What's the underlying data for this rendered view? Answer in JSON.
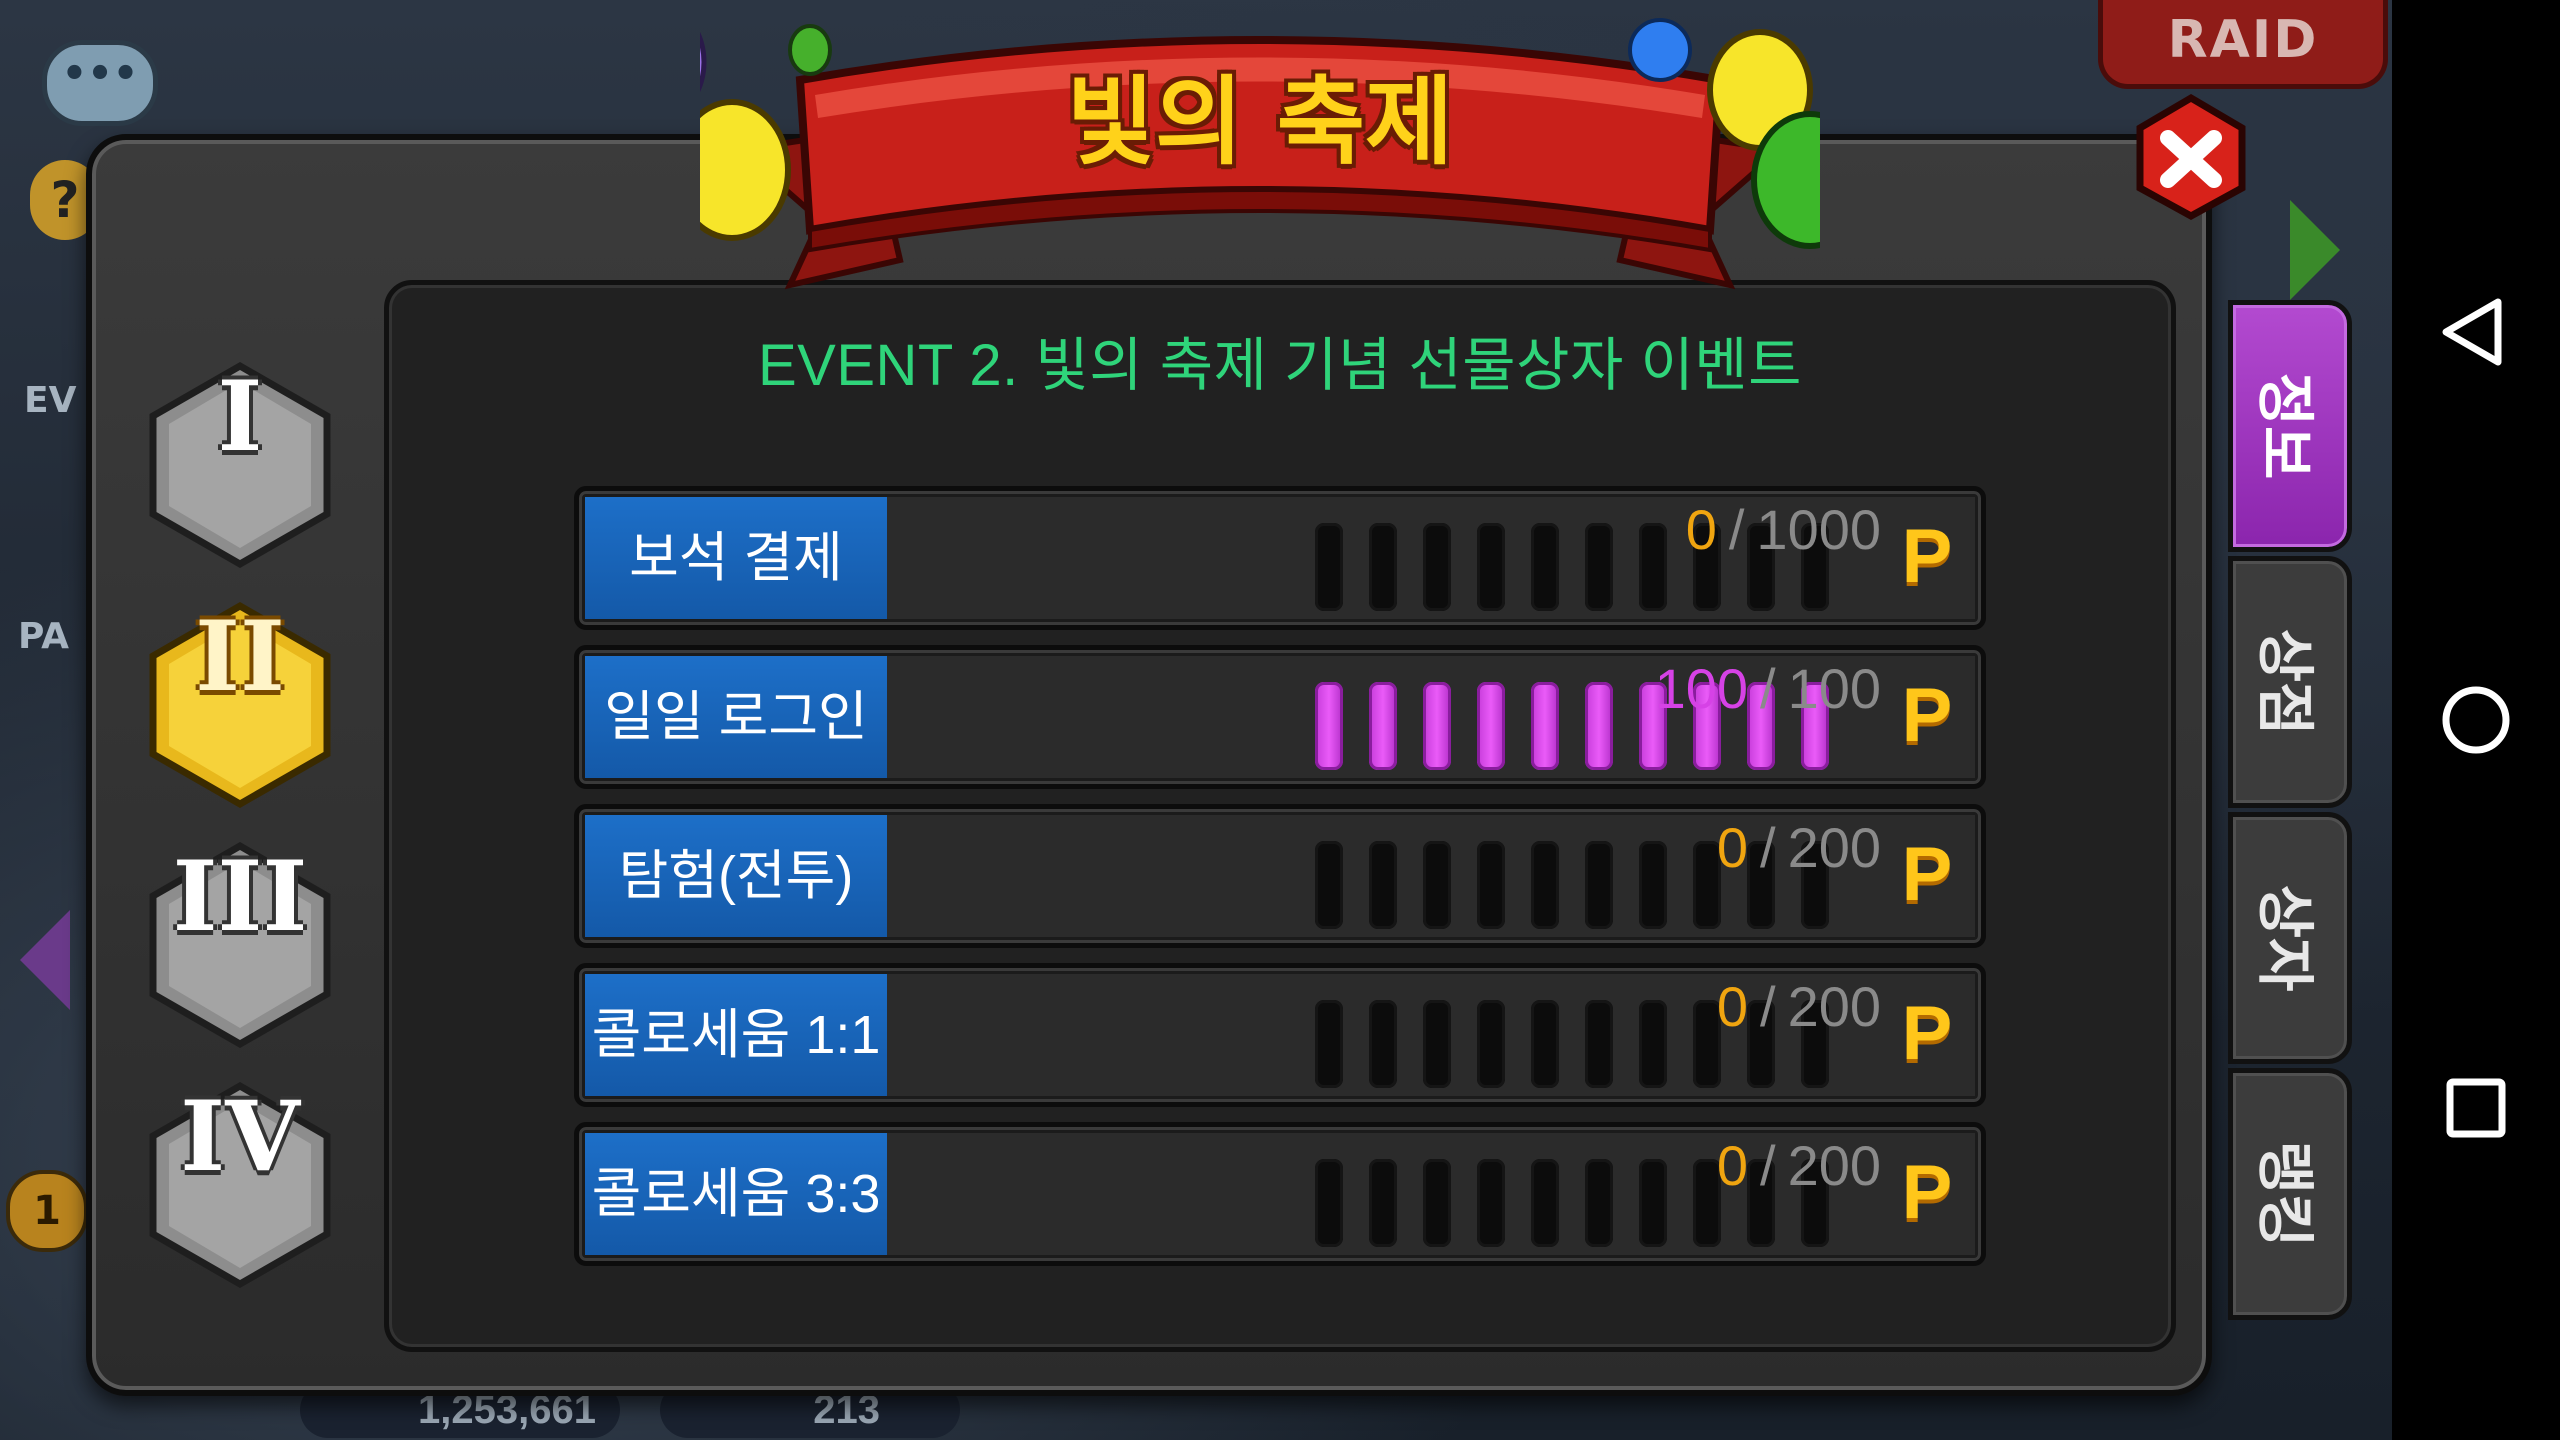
{
  "hud": {
    "raid_label": "RAID",
    "chat_glyph": "•••",
    "help_glyph": "?",
    "ev_label": "EV",
    "pa_label": "PA",
    "level": "1",
    "gold": "1,253,661",
    "gems": "213"
  },
  "banner": {
    "title": "빛의 축제"
  },
  "event": {
    "title": "EVENT 2. 빛의 축제 기념 선물상자 이벤트"
  },
  "tiers": [
    {
      "label": "I",
      "state": "inactive"
    },
    {
      "label": "II",
      "state": "active"
    },
    {
      "label": "III",
      "state": "inactive"
    },
    {
      "label": "IV",
      "state": "inactive"
    }
  ],
  "rows": [
    {
      "label": "보석 결제",
      "current": "0",
      "separator": "/",
      "max": "1000",
      "unit": "P",
      "progress": 0.0
    },
    {
      "label": "일일 로그인",
      "current": "100",
      "separator": "/",
      "max": "100",
      "unit": "P",
      "progress": 1.0
    },
    {
      "label": "탐험(전투)",
      "current": "0",
      "separator": "/",
      "max": "200",
      "unit": "P",
      "progress": 0.0
    },
    {
      "label": "콜로세움 1:1",
      "current": "0",
      "separator": "/",
      "max": "200",
      "unit": "P",
      "progress": 0.0
    },
    {
      "label": "콜로세움 3:3",
      "current": "0",
      "separator": "/",
      "max": "200",
      "unit": "P",
      "progress": 0.0
    }
  ],
  "side_tabs": [
    {
      "label": "정보",
      "active": true
    },
    {
      "label": "상점",
      "active": false
    },
    {
      "label": "상자",
      "active": false
    },
    {
      "label": "랭킹",
      "active": false
    }
  ],
  "colors": {
    "event_title": "#2fd47a",
    "row_label_bg": "#1d6fc8",
    "filled_segment": "#d642e6",
    "score_current": "#f0a510",
    "points_icon": "#ffc61a",
    "active_tab": "#a63ec6",
    "banner_red": "#c8201a",
    "banner_text": "#ffd21a"
  },
  "icons": {
    "close": "close-x-icon",
    "nav_back": "triangle-back-icon",
    "nav_home": "circle-home-icon",
    "nav_recent": "square-recent-icon"
  }
}
